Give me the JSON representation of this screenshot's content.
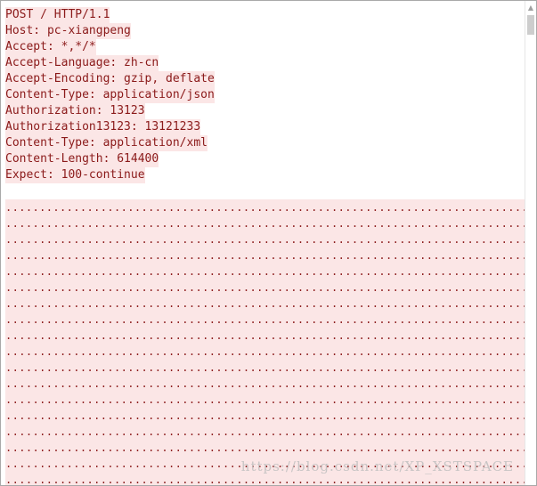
{
  "request": {
    "lines": [
      "POST / HTTP/1.1",
      "Host: pc-xiangpeng",
      "Accept: *,*/*",
      "Accept-Language: zh-cn",
      "Accept-Encoding: gzip, deflate",
      "Content-Type: application/json",
      "Authorization: 13123",
      "Authorization13123: 13121233",
      "Content-Type: application/xml",
      "Content-Length: 614400",
      "Expect: 100-continue"
    ]
  },
  "body": {
    "rows": [
      "....................................................................................................",
      "....................................................................................................",
      "....................................................................................................",
      "....................................................................................................",
      "....................................................................................................",
      "....................................................................................................",
      "....................................................................................................",
      "....................................................................................................",
      "....................................................................................................",
      "....................................................................................................",
      "....................................................................................................",
      "....................................................................................................",
      "....................................................................................................",
      "....................................................................................................",
      "....................................................................................................",
      "....................................................................................................",
      "....................................................................................................",
      "...................................................................................................."
    ]
  },
  "watermark": {
    "text": "https://blog.csdn.net/XP_XSTSPACE"
  },
  "colors": {
    "text": "#8b1a1a",
    "highlight": "#fbe6e6"
  }
}
